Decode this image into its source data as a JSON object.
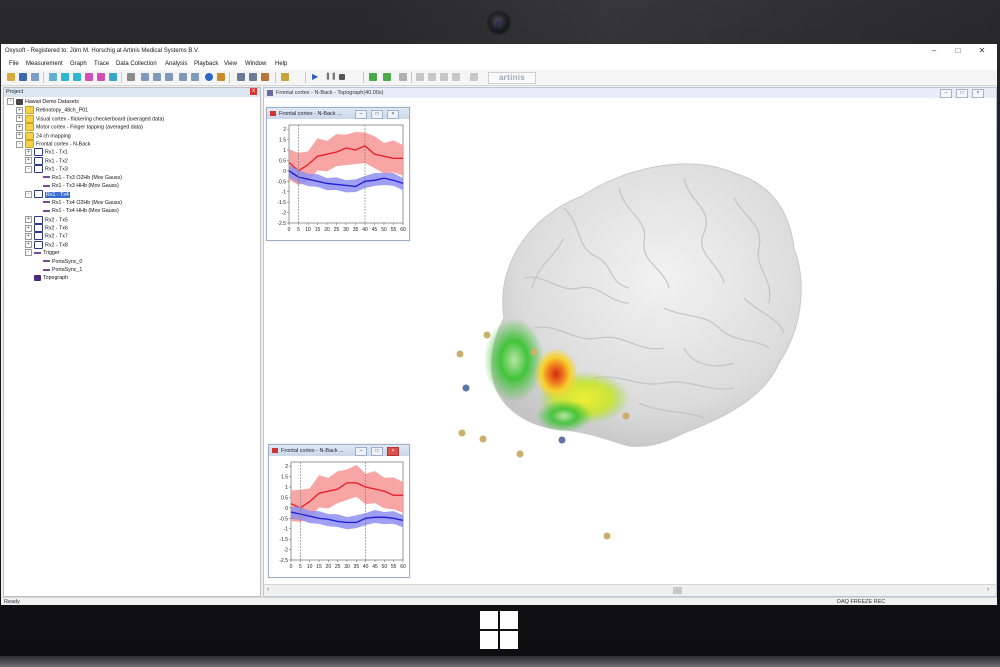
{
  "app": {
    "title": "Oxysoft - Registered to: Jörn M. Horschig at Artinis Medical Systems B.V.",
    "controls": {
      "minimize": "–",
      "maximize": "□",
      "close": "✕"
    }
  },
  "menu": [
    "File",
    "Measurement",
    "Graph",
    "Trace",
    "Data Collection",
    "Analysis",
    "Playback",
    "View",
    "Window",
    "Help"
  ],
  "toolbar": {
    "brand": "artinis"
  },
  "project": {
    "header": "Project",
    "close": "x",
    "tree": [
      {
        "label": "Hawaii Demo Datasets",
        "level": 0,
        "icon": "db-icon",
        "pm": "-"
      },
      {
        "label": "Retinotopy_48ch_P01",
        "level": 1,
        "icon": "folder-icon",
        "pm": "+"
      },
      {
        "label": "Visual cortex - flickering checkerboard (averaged data)",
        "level": 1,
        "icon": "folder-icon",
        "pm": "+"
      },
      {
        "label": "Motor cortex - Finger tapping (averaged data)",
        "level": 1,
        "icon": "folder-icon",
        "pm": "+"
      },
      {
        "label": "24 ch mapping",
        "level": 1,
        "icon": "folder-icon",
        "pm": "+"
      },
      {
        "label": "Frontal cortex - N-Back",
        "level": 1,
        "icon": "folder-icon",
        "pm": "-"
      },
      {
        "label": "Rx1 - Tx1",
        "level": 2,
        "icon": "link-icon",
        "pm": "+"
      },
      {
        "label": "Rx1 - Tx2",
        "level": 2,
        "icon": "link-icon",
        "pm": "+"
      },
      {
        "label": "Rx1 - Tx3",
        "level": 2,
        "icon": "link-icon",
        "pm": "-"
      },
      {
        "label": "Rx1 - Tx3 O2Hb (Mov Gauss)",
        "level": 3,
        "icon": "trace-icon",
        "pm": ""
      },
      {
        "label": "Rx1 - Tx3 HHb (Mov Gauss)",
        "level": 3,
        "icon": "trace-icon",
        "pm": ""
      },
      {
        "label": "Rx1 - Tx4",
        "level": 2,
        "icon": "link-icon",
        "pm": "-",
        "selected": true
      },
      {
        "label": "Rx1 - Tx4 O2Hb (Mov Gauss)",
        "level": 3,
        "icon": "trace-icon",
        "pm": ""
      },
      {
        "label": "Rx1 - Tx4 HHb (Mov Gauss)",
        "level": 3,
        "icon": "trace-icon",
        "pm": ""
      },
      {
        "label": "Rx2 - Tx5",
        "level": 2,
        "icon": "link-icon",
        "pm": "+"
      },
      {
        "label": "Rx2 - Tx6",
        "level": 2,
        "icon": "link-icon",
        "pm": "+"
      },
      {
        "label": "Rx2 - Tx7",
        "level": 2,
        "icon": "link-icon",
        "pm": "+"
      },
      {
        "label": "Rx2 - Tx8",
        "level": 2,
        "icon": "link-icon",
        "pm": "+"
      },
      {
        "label": "Trigger",
        "level": 2,
        "icon": "trace-icon",
        "pm": "-"
      },
      {
        "label": "PortaSync_0",
        "level": 3,
        "icon": "trace-icon",
        "pm": ""
      },
      {
        "label": "PortaSync_1",
        "level": 3,
        "icon": "trace-icon",
        "pm": ""
      },
      {
        "label": "Topograph",
        "level": 2,
        "icon": "topograph-icon",
        "pm": ""
      }
    ]
  },
  "topograph_window": {
    "title": "Frontal cortex - N-Back - Topograph(40.00s)"
  },
  "graph_windows": [
    {
      "title": "Frontal cortex - N-Back ..."
    },
    {
      "title": "Frontal cortex - N-Back ..."
    }
  ],
  "status": {
    "left": "Ready",
    "right": "DAQ  FREEZE  REC"
  },
  "colors": {
    "o2hb": "#e8242a",
    "o2hb_band": "#f79595",
    "hhb": "#2222d8",
    "hhb_band": "#8f8ff0",
    "selection": "#3a6ccf"
  },
  "chart_data": [
    {
      "type": "line",
      "x": [
        0,
        5,
        10,
        15,
        20,
        25,
        30,
        35,
        40,
        45,
        50,
        55,
        60
      ],
      "xticks": [
        "0",
        "5",
        "10",
        "15",
        "20",
        "25",
        "30",
        "35",
        "40",
        "45",
        "50",
        "55",
        "60"
      ],
      "yticks": [
        "2",
        "1.5",
        "1",
        "0.5",
        "0",
        "-0.5",
        "-1",
        "-1.5",
        "-2",
        "-2.5"
      ],
      "ylim": [
        -2.5,
        2.2
      ],
      "series": [
        {
          "values": [
            0.4,
            0.0,
            0.3,
            0.7,
            0.8,
            0.9,
            1.1,
            1.0,
            1.2,
            0.8,
            0.7,
            0.6,
            0.6
          ],
          "band": 0.75
        },
        {
          "values": [
            0.0,
            -0.3,
            -0.4,
            -0.5,
            -0.6,
            -0.65,
            -0.7,
            -0.75,
            -0.5,
            -0.45,
            -0.35,
            -0.45,
            -0.6
          ],
          "band": 0.3
        }
      ]
    },
    {
      "type": "line",
      "x": [
        0,
        5,
        10,
        15,
        20,
        25,
        30,
        35,
        40,
        45,
        50,
        55,
        60
      ],
      "xticks": [
        "0",
        "5",
        "10",
        "15",
        "20",
        "25",
        "30",
        "35",
        "40",
        "45",
        "50",
        "55",
        "60"
      ],
      "yticks": [
        "2",
        "1.5",
        "1",
        "0.5",
        "0",
        "-0.5",
        "-1",
        "-1.5",
        "-2",
        "-2.5"
      ],
      "ylim": [
        -2.5,
        2.2
      ],
      "series": [
        {
          "values": [
            0.2,
            0.0,
            0.3,
            0.7,
            0.8,
            0.9,
            1.2,
            1.2,
            1.0,
            0.9,
            0.8,
            0.6,
            0.6
          ],
          "band": 0.75
        },
        {
          "values": [
            -0.2,
            -0.3,
            -0.4,
            -0.5,
            -0.55,
            -0.65,
            -0.7,
            -0.7,
            -0.5,
            -0.45,
            -0.45,
            -0.5,
            -0.6
          ],
          "band": 0.3
        }
      ]
    }
  ]
}
